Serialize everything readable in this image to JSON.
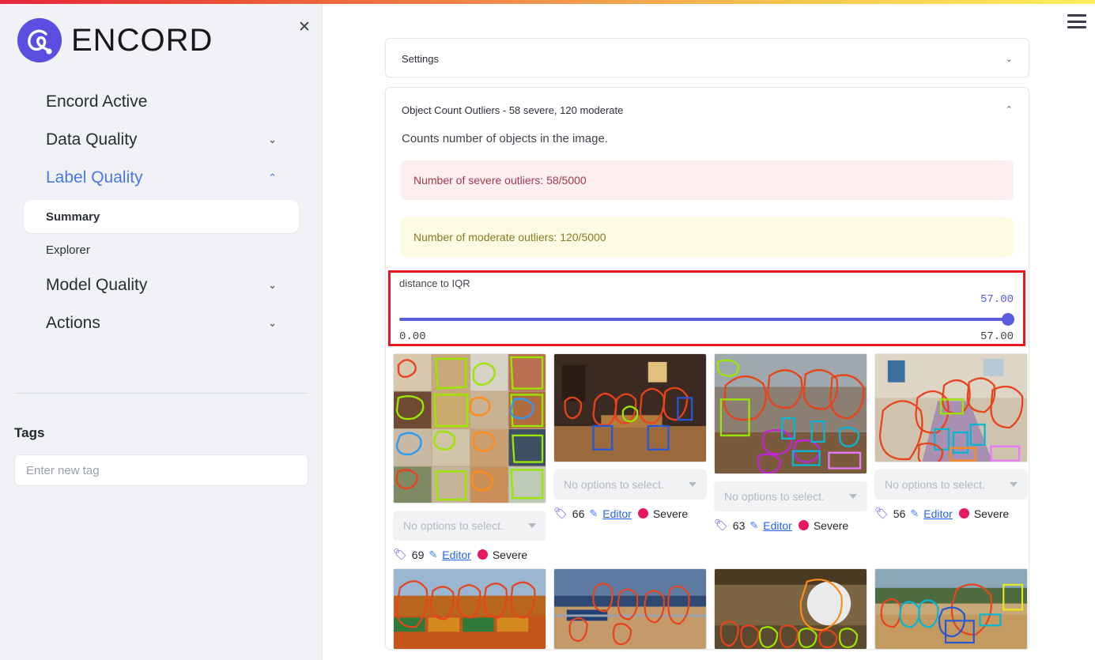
{
  "window": {
    "accent_gradient_from": "#e8263c",
    "accent_gradient_to": "#fbef5a",
    "menu_icon": "hamburger-icon"
  },
  "sidebar": {
    "brand_name": "ENCORD",
    "brand_logo_icon": "encord-logo-icon",
    "close_icon": "close-icon",
    "nav": [
      {
        "label": "Encord Active",
        "expandable": false,
        "active": false,
        "chevron": ""
      },
      {
        "label": "Data Quality",
        "expandable": true,
        "active": false,
        "chevron": "⌄"
      },
      {
        "label": "Label Quality",
        "expandable": true,
        "active": true,
        "chevron": "⌃"
      },
      {
        "label": "Model Quality",
        "expandable": true,
        "active": false,
        "chevron": "⌄"
      },
      {
        "label": "Actions",
        "expandable": true,
        "active": false,
        "chevron": "⌄"
      }
    ],
    "subnav": [
      {
        "label": "Summary",
        "selected": true
      },
      {
        "label": "Explorer",
        "selected": false
      }
    ],
    "tags_heading": "Tags",
    "tag_input_placeholder": "Enter new tag",
    "tag_input_value": ""
  },
  "main": {
    "settings_card": {
      "title": "Settings",
      "chevron": "⌄"
    },
    "metric_card": {
      "title": "Object Count Outliers - 58 severe, 120 moderate",
      "chevron": "⌃",
      "description": "Counts number of objects in the image.",
      "severe_alert": "Number of severe outliers: 58/5000",
      "moderate_alert": "Number of moderate outliers: 120/5000",
      "severe_color": "#a03a4c",
      "moderate_color": "#8a7a24"
    },
    "slider": {
      "label": "distance to IQR",
      "current_value": "57.00",
      "min_label": "0.00",
      "max_label": "57.00",
      "accent_color": "#5a5ce0",
      "highlight_color": "#e8161e"
    },
    "grid": {
      "dropdown_placeholder": "No options to select.",
      "editor_label": "Editor",
      "severity_label": "Severe",
      "tag_icon": "tag-icon",
      "pencil_icon": "pencil-edit-icon",
      "items": [
        {
          "count": "69",
          "editor": "Editor",
          "severity": "Severe",
          "alt": "collage of food platters with green and orange polygon annotations"
        },
        {
          "count": "66",
          "editor": "Editor",
          "severity": "Severe",
          "alt": "restaurant interior with people seated at tables, red and blue polygon annotations"
        },
        {
          "count": "63",
          "editor": "Editor",
          "severity": "Severe",
          "alt": "outdoor cafe table with group of people, red magenta and cyan annotations"
        },
        {
          "count": "56",
          "editor": "Editor",
          "severity": "Severe",
          "alt": "long dining table with large family, red and cyan annotations"
        },
        {
          "count": "",
          "editor": "",
          "severity": "",
          "alt": "outdoor market stalls with produce crates and red person annotations"
        },
        {
          "count": "",
          "editor": "",
          "severity": "",
          "alt": "stadium rodeo arena with crowd and red person annotations"
        },
        {
          "count": "",
          "editor": "",
          "severity": "",
          "alt": "indoor hall with large clock and crowd with orange annotations"
        },
        {
          "count": "",
          "editor": "",
          "severity": "",
          "alt": "outdoor sports field with wheelchair athlete and red annotations"
        }
      ]
    }
  }
}
